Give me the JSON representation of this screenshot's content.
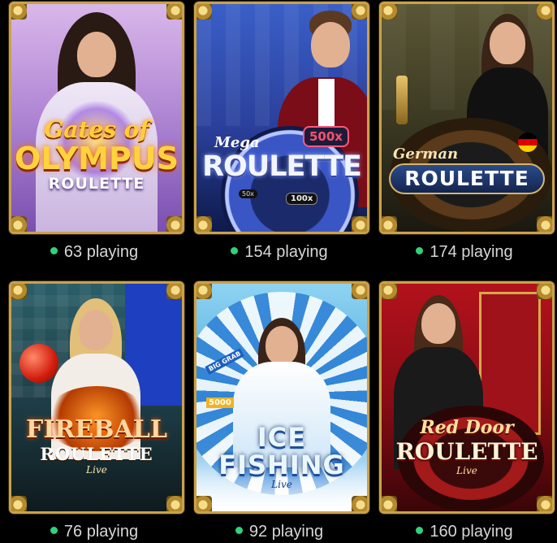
{
  "tiles": [
    {
      "title_small": "Gates of",
      "title_big": "OLYMPUS",
      "title_sub": "ROULETTE",
      "playing": "63 playing"
    },
    {
      "title_small": "Mega",
      "title_big": "ROULETTE",
      "multiplier_a": "500x",
      "multiplier_b": "100x",
      "multiplier_c": "50x",
      "playing": "154 playing"
    },
    {
      "title_small": "German",
      "title_big": "ROULETTE",
      "playing": "174 playing"
    },
    {
      "title_big": "FIREBALL",
      "title_sub": "ROULETTE",
      "title_live": "Live",
      "playing": "76 playing"
    },
    {
      "title_big": "ICE",
      "title_sub": "FISHING",
      "title_live": "Live",
      "wheel_label_a": "BIG GRAB",
      "wheel_label_b": "5000",
      "playing": "92 playing"
    },
    {
      "title_small": "Red Door",
      "title_big": "ROULETTE",
      "title_live": "Live",
      "playing": "160 playing"
    }
  ],
  "colors": {
    "frame_gold": "#c9a24a",
    "status_dot": "#2fd37a",
    "count_text": "#d7d7d7"
  }
}
